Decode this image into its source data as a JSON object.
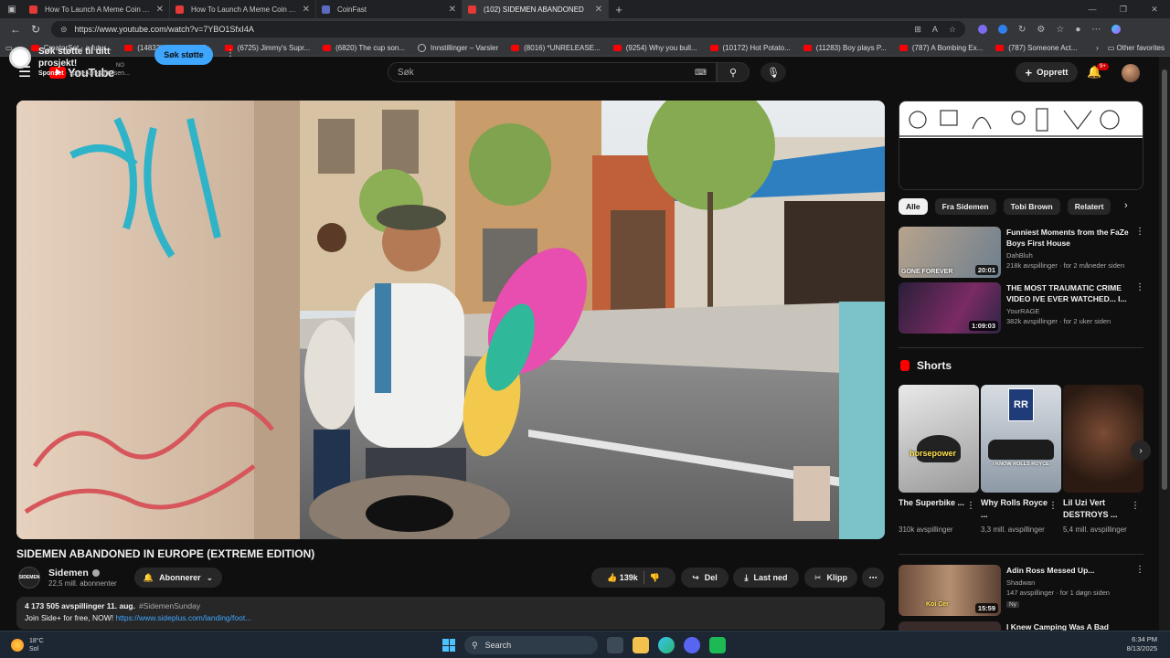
{
  "browser": {
    "tabs": [
      {
        "title": "How To Launch A Meme Coin And",
        "fav": "#e53935",
        "active": false
      },
      {
        "title": "How To Launch A Meme Coin And",
        "fav": "#e53935",
        "active": false
      },
      {
        "title": "CoinFast",
        "fav": "#5c6bc0",
        "active": false
      },
      {
        "title": "(102) SIDEMEN ABANDONED",
        "fav": "#e53935",
        "active": true
      }
    ],
    "url": "https://www.youtube.com/watch?v=7YBO1SfxI4A",
    "bookmarks": [
      {
        "label": "CreatorSet - a futur...",
        "kind": "yt"
      },
      {
        "label": "(14833) Easy TWO P...",
        "kind": "yt"
      },
      {
        "label": "(6725) Jimmy's Supr...",
        "kind": "yt"
      },
      {
        "label": "(6820) The cup son...",
        "kind": "yt"
      },
      {
        "label": "Innstillinger – Varsler",
        "kind": "globe"
      },
      {
        "label": "(8016) *UNRELEASE...",
        "kind": "yt"
      },
      {
        "label": "(9254) Why you bull...",
        "kind": "yt"
      },
      {
        "label": "(10172) Hot Potato...",
        "kind": "yt"
      },
      {
        "label": "(11283) Boy plays P...",
        "kind": "yt"
      },
      {
        "label": "(787) A Bombing Ex...",
        "kind": "yt"
      },
      {
        "label": "(787) Someone Act...",
        "kind": "yt"
      }
    ],
    "other_favorites": "Other favorites"
  },
  "youtube": {
    "logo_text": "YouTube",
    "country": "NO",
    "search_placeholder": "Søk",
    "create_label": "Opprett",
    "notif_badge": "9+"
  },
  "video": {
    "title": "SIDEMEN ABANDONED IN EUROPE (EXTREME EDITION)",
    "channel": "Sidemen",
    "channel_avatar_text": "SIDEMEN",
    "subscribers": "22,5 mill. abonnenter",
    "subscribe_label": "Abonnerer",
    "likes": "139k",
    "share_label": "Del",
    "download_label": "Last ned",
    "clip_label": "Klipp",
    "views_date": "4 173 505 avspillinger  11. aug.",
    "hashtag": "#SidemenSunday",
    "desc_text": "Join Side+ for free, NOW! ",
    "desc_link": "https://www.sideplus.com/landing/foot..."
  },
  "ad": {
    "title": "Søk støtte til ditt prosjekt!",
    "sponsored": "Sponset",
    "advertiser": "· sparebankstiftelsen...",
    "button": "Søk støtte"
  },
  "chips": [
    "Alle",
    "Fra Sidemen",
    "Tobi Brown",
    "Relatert"
  ],
  "recommendations": [
    {
      "title": "Funniest Moments from the FaZe Boys First House",
      "channel": "DahBluh",
      "meta": "218k avspillinger · for 2 måneder siden",
      "duration": "20:01",
      "thumb_text": "GONE FOREVER",
      "badge": ""
    },
    {
      "title": "THE MOST TRAUMATIC CRIME VIDEO IVE EVER WATCHED... I...",
      "channel": "YourRAGE",
      "meta": "382k avspillinger · for 2 uker siden",
      "duration": "1:09:03",
      "thumb_text": "",
      "badge": ""
    },
    {
      "title": "Adin Ross Messed Up...",
      "channel": "Shadwan",
      "meta": "147 avspillinger · for 1 døgn siden",
      "duration": "15:59",
      "thumb_text": "Koi Cer",
      "badge": "Ny"
    },
    {
      "title": "I Knew Camping Was A Bad",
      "channel": "",
      "meta": "",
      "duration": "",
      "thumb_text": "",
      "badge": ""
    }
  ],
  "shorts": {
    "heading": "Shorts",
    "items": [
      {
        "title": "The Superbike ...",
        "views": "310k avspillinger",
        "overlay": "horsepower"
      },
      {
        "title": "Why Rolls Royce ...",
        "views": "3,3 mill. avspillinger",
        "overlay": "I KNOW ROLLS ROYCE"
      },
      {
        "title": "Lil Uzi Vert DESTROYS ...",
        "views": "5,4 mill. avspillinger",
        "overlay": ""
      }
    ]
  },
  "taskbar": {
    "temp": "18°C",
    "condition": "Sol",
    "search": "Search",
    "time": "6:34 PM",
    "date": "8/13/2025"
  }
}
